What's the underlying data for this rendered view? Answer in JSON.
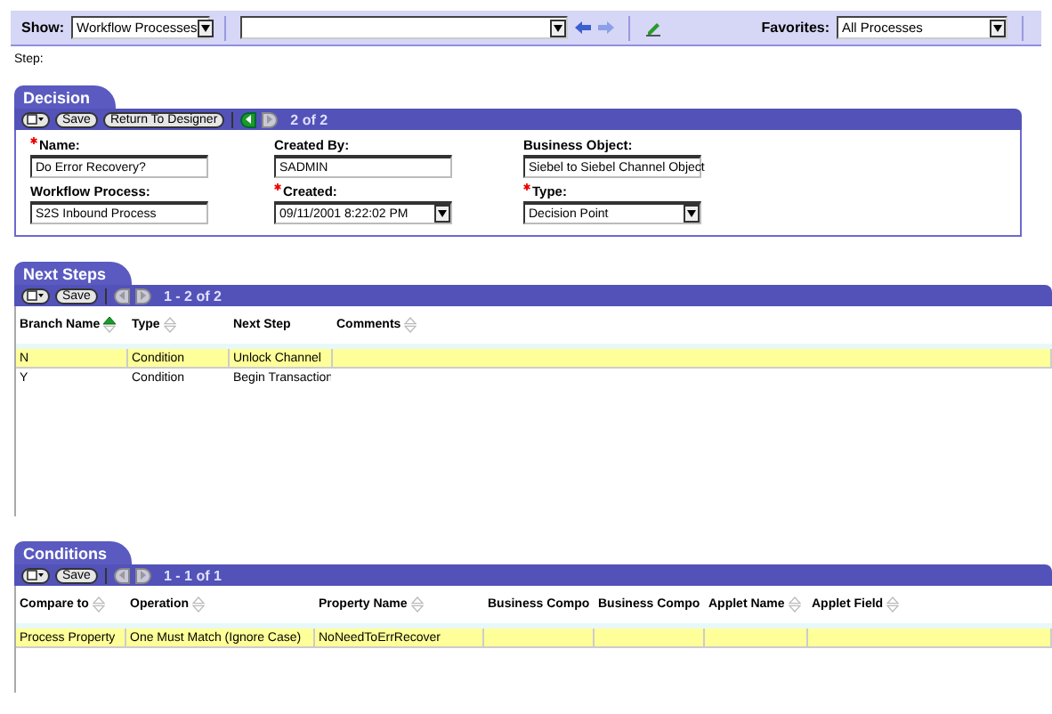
{
  "toolbar": {
    "show_label": "Show:",
    "show_value": "Workflow Processes",
    "favorites_label": "Favorites:",
    "favorites_value": "All Processes"
  },
  "step_label": "Step:",
  "decision": {
    "title": "Decision",
    "buttons": [
      "Save",
      "Return To Designer"
    ],
    "prev_enabled": true,
    "next_enabled": false,
    "pager": "2 of 2",
    "fields": [
      {
        "label": "Name:",
        "required": true,
        "value": "Do Error Recovery?",
        "kind": "text"
      },
      {
        "label": "Created By:",
        "required": false,
        "value": "SADMIN",
        "kind": "text"
      },
      {
        "label": "Business Object:",
        "required": false,
        "value": "Siebel to Siebel Channel Object",
        "kind": "text"
      },
      {
        "label": "Workflow Process:",
        "required": false,
        "value": "S2S Inbound Process",
        "kind": "text"
      },
      {
        "label": "Created:",
        "required": true,
        "value": "09/11/2001 8:22:02 PM",
        "kind": "select"
      },
      {
        "label": "Type:",
        "required": true,
        "value": "Decision Point",
        "kind": "select"
      }
    ]
  },
  "next_steps": {
    "title": "Next Steps",
    "buttons": [
      "Save"
    ],
    "prev_enabled": false,
    "next_enabled": false,
    "pager": "1 - 2 of 2",
    "columns": [
      {
        "label": "Branch Name",
        "sortable": true,
        "sorted": true
      },
      {
        "label": "Type",
        "sortable": true,
        "sorted": false
      },
      {
        "label": "Next Step",
        "sortable": false,
        "sorted": false
      },
      {
        "label": "Comments",
        "sortable": true,
        "sorted": false
      }
    ],
    "rows": [
      {
        "selected": true,
        "cells": [
          "N",
          "Condition",
          "Unlock Channel",
          ""
        ]
      },
      {
        "selected": false,
        "cells": [
          "Y",
          "Condition",
          "Begin Transaction",
          ""
        ]
      }
    ]
  },
  "conditions": {
    "title": "Conditions",
    "buttons": [
      "Save"
    ],
    "prev_enabled": false,
    "next_enabled": false,
    "pager": "1 - 1 of 1",
    "columns": [
      {
        "label": "Compare to",
        "sortable": true,
        "sorted": false
      },
      {
        "label": "Operation",
        "sortable": true,
        "sorted": false
      },
      {
        "label": "Property Name",
        "sortable": true,
        "sorted": false
      },
      {
        "label": "Business Compo",
        "sortable": false,
        "sorted": false
      },
      {
        "label": "Business Compo",
        "sortable": false,
        "sorted": false
      },
      {
        "label": "Applet Name",
        "sortable": true,
        "sorted": false
      },
      {
        "label": "Applet Field",
        "sortable": true,
        "sorted": false
      }
    ],
    "rows": [
      {
        "selected": true,
        "cells": [
          "Process Property",
          "One Must Match (Ignore Case)",
          "NoNeedToErrRecover",
          "",
          "",
          "",
          ""
        ]
      }
    ]
  }
}
